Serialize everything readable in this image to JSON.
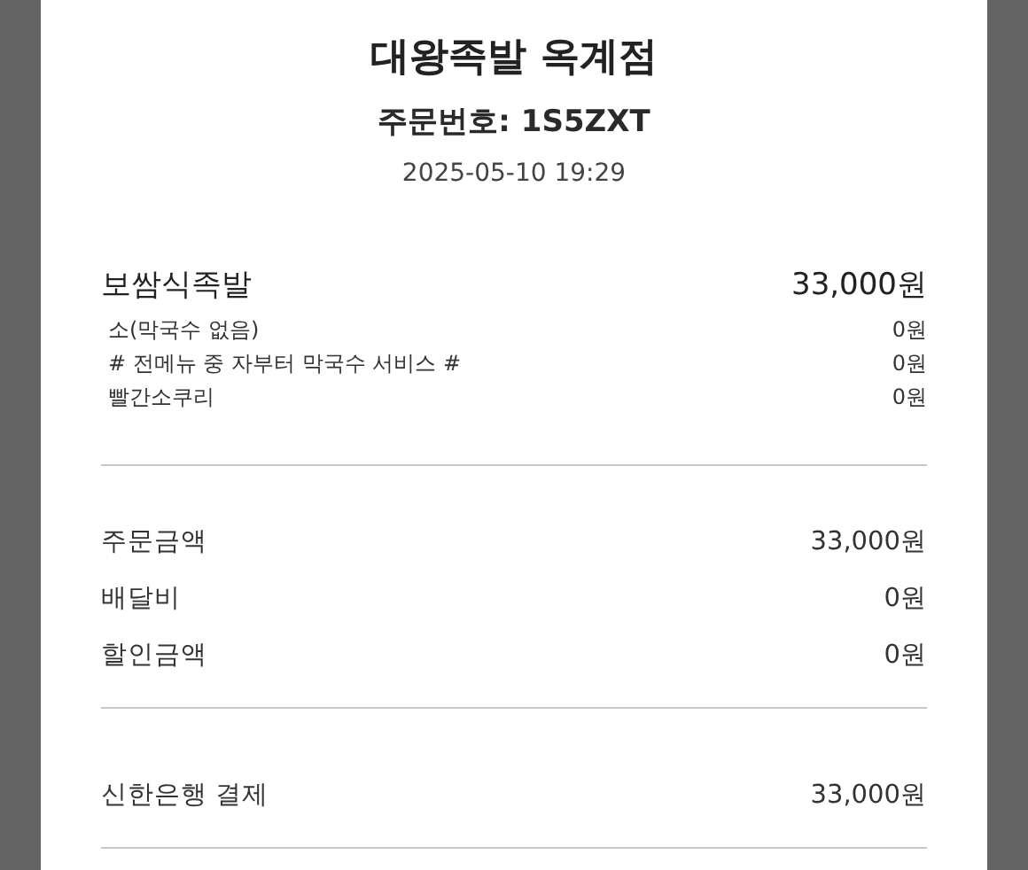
{
  "store_name": "대왕족발 옥계점",
  "order_number": "주문번호: 1S5ZXT",
  "order_time": "2025-05-10 19:29",
  "menu_items": [
    {
      "name": "보쌈식족발",
      "price": "33,000원",
      "options": [
        {
          "name": "소(막국수 없음)",
          "price": "0원"
        },
        {
          "name": "# 전메뉴 중 자부터 막국수 서비스 #",
          "price": "0원"
        },
        {
          "name": "빨간소쿠리",
          "price": "0원"
        }
      ]
    }
  ],
  "summary": [
    {
      "label": "주문금액",
      "value": "33,000원"
    },
    {
      "label": "배달비",
      "value": "0원"
    },
    {
      "label": "할인금액",
      "value": "0원"
    }
  ],
  "payment": {
    "label": "신한은행 결제",
    "value": "33,000원"
  }
}
